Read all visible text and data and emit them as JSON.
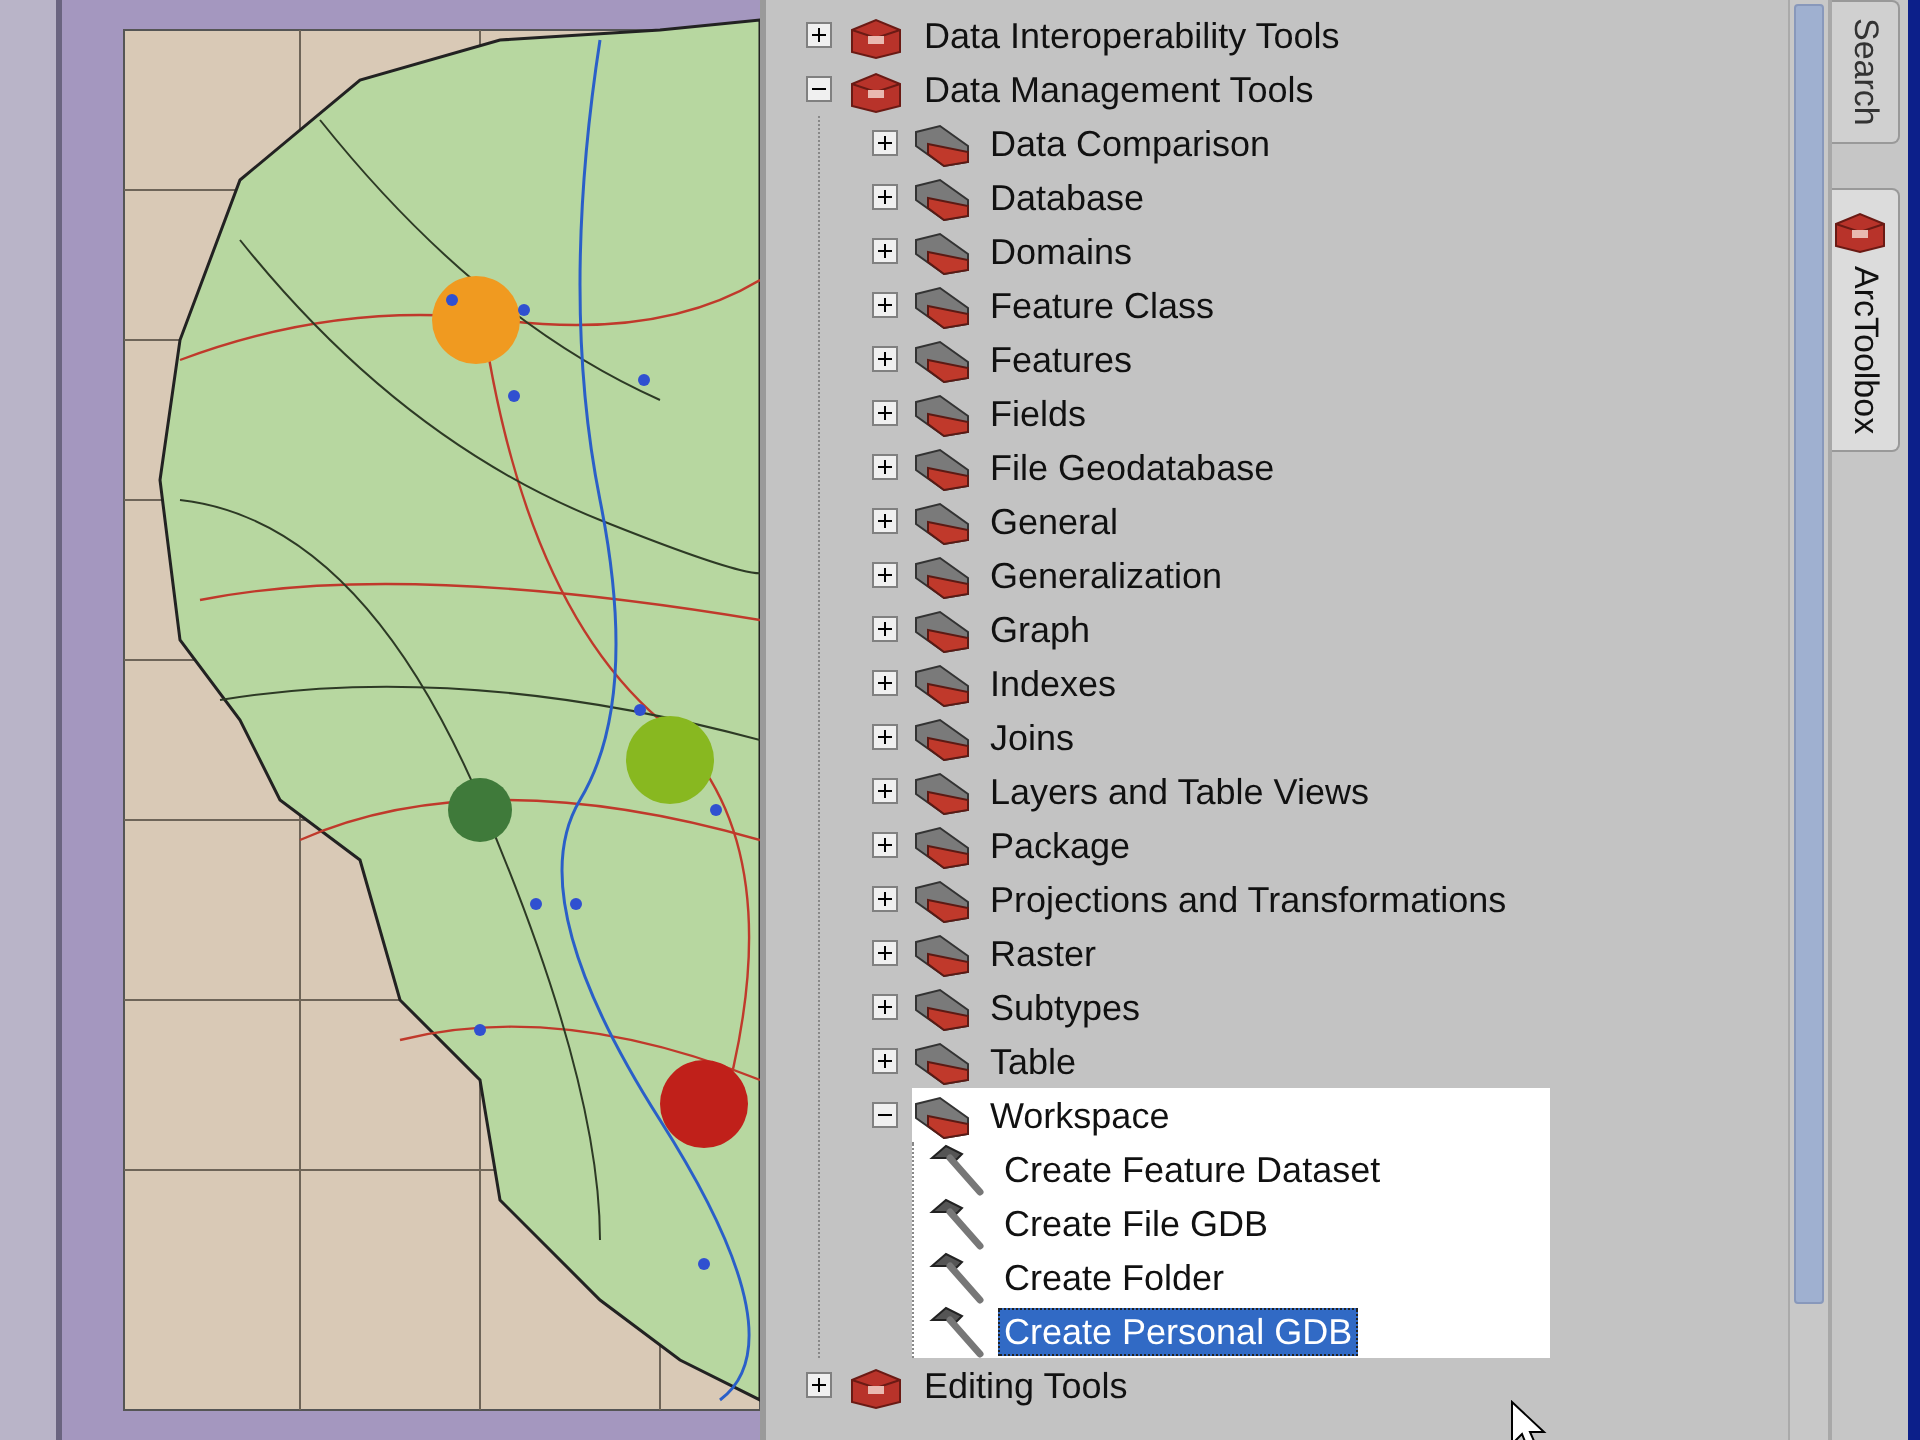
{
  "toolbox_tree": [
    {
      "label": "Data Interoperability Tools",
      "kind": "toolbox",
      "expanded": false,
      "selected": false
    },
    {
      "label": "Data Management Tools",
      "kind": "toolbox",
      "expanded": true,
      "selected": false,
      "children": [
        {
          "label": "Data Comparison",
          "kind": "toolset",
          "expanded": false,
          "selected": false
        },
        {
          "label": "Database",
          "kind": "toolset",
          "expanded": false,
          "selected": false
        },
        {
          "label": "Domains",
          "kind": "toolset",
          "expanded": false,
          "selected": false
        },
        {
          "label": "Feature Class",
          "kind": "toolset",
          "expanded": false,
          "selected": false
        },
        {
          "label": "Features",
          "kind": "toolset",
          "expanded": false,
          "selected": false
        },
        {
          "label": "Fields",
          "kind": "toolset",
          "expanded": false,
          "selected": false
        },
        {
          "label": "File Geodatabase",
          "kind": "toolset",
          "expanded": false,
          "selected": false
        },
        {
          "label": "General",
          "kind": "toolset",
          "expanded": false,
          "selected": false
        },
        {
          "label": "Generalization",
          "kind": "toolset",
          "expanded": false,
          "selected": false
        },
        {
          "label": "Graph",
          "kind": "toolset",
          "expanded": false,
          "selected": false
        },
        {
          "label": "Indexes",
          "kind": "toolset",
          "expanded": false,
          "selected": false
        },
        {
          "label": "Joins",
          "kind": "toolset",
          "expanded": false,
          "selected": false
        },
        {
          "label": "Layers and Table Views",
          "kind": "toolset",
          "expanded": false,
          "selected": false
        },
        {
          "label": "Package",
          "kind": "toolset",
          "expanded": false,
          "selected": false
        },
        {
          "label": "Projections and Transformations",
          "kind": "toolset",
          "expanded": false,
          "selected": false
        },
        {
          "label": "Raster",
          "kind": "toolset",
          "expanded": false,
          "selected": false
        },
        {
          "label": "Subtypes",
          "kind": "toolset",
          "expanded": false,
          "selected": false
        },
        {
          "label": "Table",
          "kind": "toolset",
          "expanded": false,
          "selected": false
        },
        {
          "label": "Workspace",
          "kind": "toolset",
          "expanded": true,
          "selected": false,
          "children": [
            {
              "label": "Create Feature Dataset",
              "kind": "tool",
              "selected": false
            },
            {
              "label": "Create File GDB",
              "kind": "tool",
              "selected": false
            },
            {
              "label": "Create Folder",
              "kind": "tool",
              "selected": false
            },
            {
              "label": "Create Personal GDB",
              "kind": "tool",
              "selected": true
            }
          ]
        }
      ]
    },
    {
      "label": "Editing Tools",
      "kind": "toolbox",
      "expanded": false,
      "selected": false
    }
  ],
  "side_tabs": [
    {
      "label": "Search",
      "selected": false,
      "icon": false
    },
    {
      "label": "ArcToolbox",
      "selected": true,
      "icon": true
    }
  ]
}
